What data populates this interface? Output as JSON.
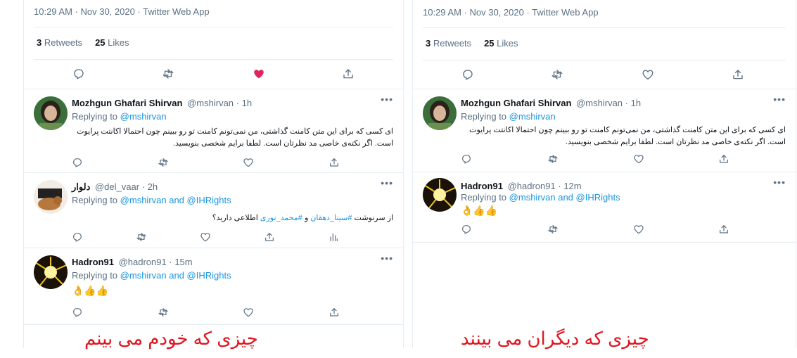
{
  "left": {
    "meta": "10:29 AM · Nov 30, 2020 · Twitter Web App",
    "stats": {
      "retweets_count": "3",
      "retweets_label": "Retweets",
      "likes_count": "25",
      "likes_label": "Likes"
    },
    "liked": true,
    "replies": [
      {
        "name": "Mozhgun Ghafari Shirvan",
        "handle": "@mshirvan",
        "dot": "·",
        "time": "1h",
        "replying_label": "Replying to",
        "replying_to": "@mshirvan",
        "text_line1": "ای کسی که برای این متن کامنت گذاشتی، من نمی‌تونم کامنت تو رو ببینم چون احتمالا اکانتت پرایوت",
        "text_line2": "است. اگر نکته‌ی خاصی مد نظرتان است. لطفا برایم شخصی بنویسید."
      },
      {
        "name": "دلوار",
        "handle": "@del_vaar",
        "dot": "·",
        "time": "2h",
        "replying_label": "Replying to",
        "replying_to": "@mshirvan and @IHRights",
        "text_part1": "از سرنوشت ",
        "hashtag1": "#سینا_دهقان",
        "text_part2": " و ",
        "hashtag2": "#محمد_نوری",
        "text_part3": " اطلاعی دارید؟"
      },
      {
        "name": "Hadron91",
        "handle": "@hadron91",
        "dot": "·",
        "time": "15m",
        "replying_label": "Replying to",
        "replying_to": "@mshirvan and @IHRights",
        "text": "👌👍👍"
      }
    ],
    "caption": "چیزی که خودم می بینم"
  },
  "right": {
    "meta": "10:29 AM · Nov 30, 2020 · Twitter Web App",
    "stats": {
      "retweets_count": "3",
      "retweets_label": "Retweets",
      "likes_count": "25",
      "likes_label": "Likes"
    },
    "liked": false,
    "replies": [
      {
        "name": "Mozhgun Ghafari Shirvan",
        "handle": "@mshirvan",
        "dot": "·",
        "time": "1h",
        "replying_label": "Replying to",
        "replying_to": "@mshirvan",
        "text_line1": "ای کسی که برای این متن کامنت گذاشتی، من نمی‌تونم کامنت تو رو ببینم چون احتمالا اکانتت پرایوت",
        "text_line2": "است. اگر نکته‌ی خاصی مد نظرتان است. لطفا برایم شخصی بنویسید."
      },
      {
        "name": "Hadron91",
        "handle": "@hadron91",
        "dot": "·",
        "time": "12m",
        "replying_label": "Replying to",
        "replying_to": "@mshirvan and @IHRights",
        "text": "👌👍👍"
      }
    ],
    "caption": "چیزی که دیگران می بینند"
  },
  "more_glyph": "•••",
  "colors": {
    "link": "#1b95e0",
    "like_active": "#e0245e",
    "icon": "#5b7083",
    "caption": "#e0141e"
  }
}
